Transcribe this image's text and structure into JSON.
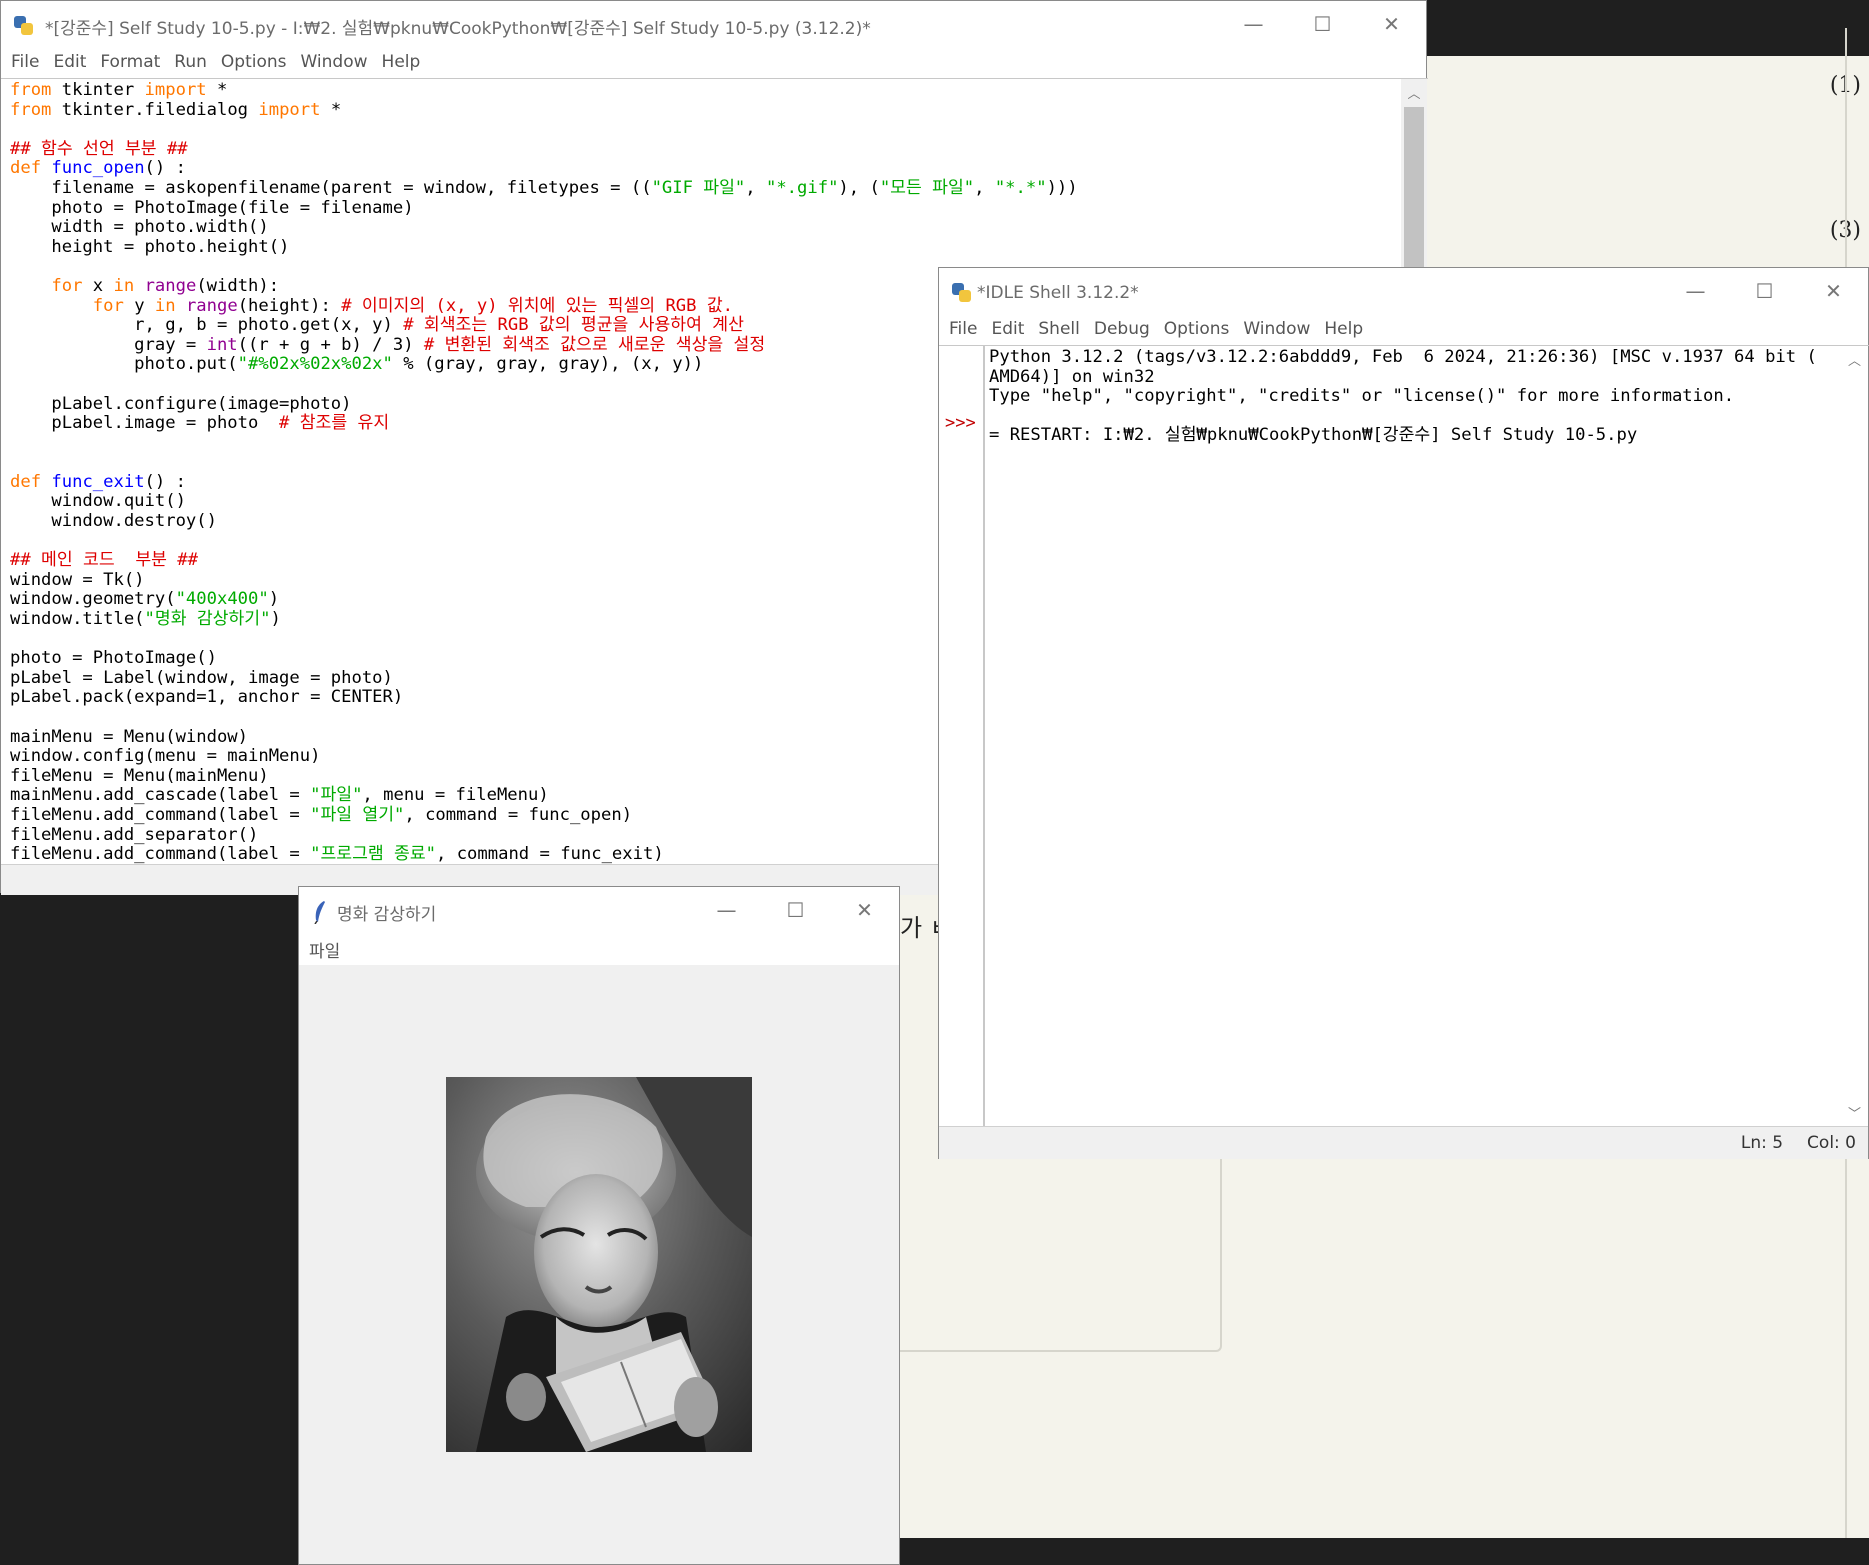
{
  "background_document": {
    "margin_markers": [
      "(1)",
      "(3)"
    ],
    "partial_text": "가 ㅂ"
  },
  "editor": {
    "title": "*[강준수] Self Study 10-5.py - I:₩2. 실험₩pknu₩CookPython₩[강준수] Self Study 10-5.py (3.12.2)*",
    "menu": [
      "File",
      "Edit",
      "Format",
      "Run",
      "Options",
      "Window",
      "Help"
    ],
    "controls": {
      "minimize": "—",
      "maximize": "☐",
      "close": "✕"
    },
    "code_lines": [
      "from tkinter import *",
      "from tkinter.filedialog import *",
      "",
      "## 함수 선언 부분 ##",
      "def func_open() :",
      "    filename = askopenfilename(parent = window, filetypes = ((\"GIF 파일\", \"*.gif\"), (\"모든 파일\", \"*.*\")))",
      "    photo = PhotoImage(file = filename)",
      "    width = photo.width()",
      "    height = photo.height()",
      "",
      "    for x in range(width):",
      "        for y in range(height): # 이미지의 (x, y) 위치에 있는 픽셀의 RGB 값.",
      "            r, g, b = photo.get(x, y) # 회색조는 RGB 값의 평균을 사용하여 계산",
      "            gray = int((r + g + b) / 3) # 변환된 회색조 값으로 새로운 색상을 설정",
      "            photo.put(\"#%02x%02x%02x\" % (gray, gray, gray), (x, y))",
      "",
      "    pLabel.configure(image=photo)",
      "    pLabel.image = photo  # 참조를 유지",
      "",
      "",
      "def func_exit() :",
      "    window.quit()",
      "    window.destroy()",
      "",
      "## 메인 코드  부분 ##",
      "window = Tk()",
      "window.geometry(\"400x400\")",
      "window.title(\"명화 감상하기\")",
      "",
      "photo = PhotoImage()",
      "pLabel = Label(window, image = photo)",
      "pLabel.pack(expand=1, anchor = CENTER)",
      "",
      "mainMenu = Menu(window)",
      "window.config(menu = mainMenu)",
      "fileMenu = Menu(mainMenu)",
      "mainMenu.add_cascade(label = \"파일\", menu = fileMenu)",
      "fileMenu.add_command(label = \"파일 열기\", command = func_open)",
      "fileMenu.add_separator()",
      "fileMenu.add_command(label = \"프로그램 종료\", command = func_exit)"
    ],
    "tokens": {
      "keywords": [
        "from",
        "import",
        "def",
        "for",
        "in"
      ],
      "builtins": [
        "range",
        "int"
      ]
    }
  },
  "shell": {
    "title": "*IDLE Shell 3.12.2*",
    "menu": [
      "File",
      "Edit",
      "Shell",
      "Debug",
      "Options",
      "Window",
      "Help"
    ],
    "controls": {
      "minimize": "—",
      "maximize": "☐",
      "close": "✕"
    },
    "output_lines": [
      "Python 3.12.2 (tags/v3.12.2:6abddd9, Feb  6 2024, 21:26:36) [MSC v.1937 64 bit (",
      "AMD64)] on win32",
      "Type \"help\", \"copyright\", \"credits\" or \"license()\" for more information.",
      "",
      "= RESTART: I:₩2. 실험₩pknu₩CookPython₩[강준수] Self Study 10-5.py"
    ],
    "prompt": ">>>",
    "status": {
      "line": "Ln: 5",
      "col": "Col: 0"
    }
  },
  "tk_window": {
    "title": "명화 감상하기",
    "menu": [
      "파일"
    ],
    "controls": {
      "minimize": "—",
      "maximize": "☐",
      "close": "✕"
    },
    "image_description_name": "grayscale-painting"
  }
}
